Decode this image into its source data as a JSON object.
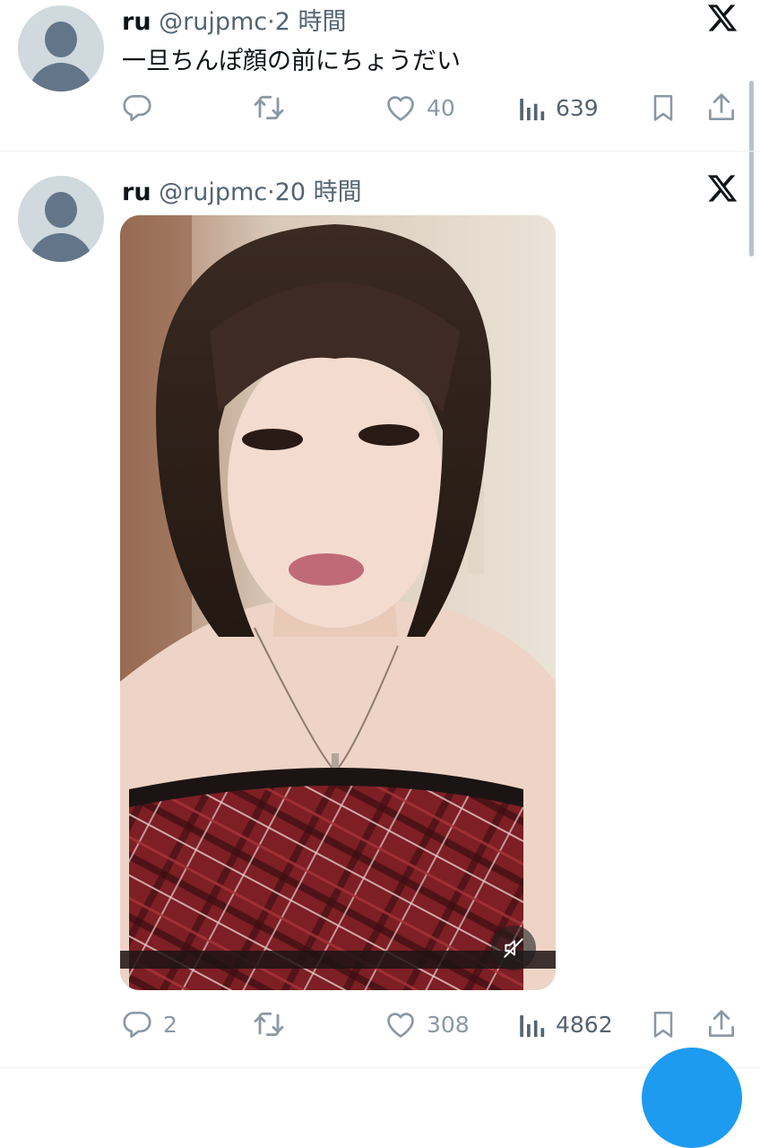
{
  "tweets": [
    {
      "name": "ru",
      "handle": "@rujpmc",
      "dot": "·",
      "time": "2 時間",
      "text": "一旦ちんぽ顔の前にちょうだい",
      "replies": "",
      "retweets": "",
      "likes": "40",
      "views": "639"
    },
    {
      "name": "ru",
      "handle": "@rujpmc",
      "dot": "·",
      "time": "20 時間",
      "replies": "2",
      "retweets": "",
      "likes": "308",
      "views": "4862"
    }
  ],
  "icons": {
    "logo": "x-logo-icon",
    "reply": "reply-icon",
    "retweet": "retweet-icon",
    "like": "heart-icon",
    "views": "bar-chart-icon",
    "bookmark": "bookmark-icon",
    "share": "share-icon",
    "mute": "muted-speaker-icon"
  },
  "colors": {
    "icon_gray": "#8b98a5",
    "text_gray": "#536471",
    "accent": "#1d9bf0"
  }
}
